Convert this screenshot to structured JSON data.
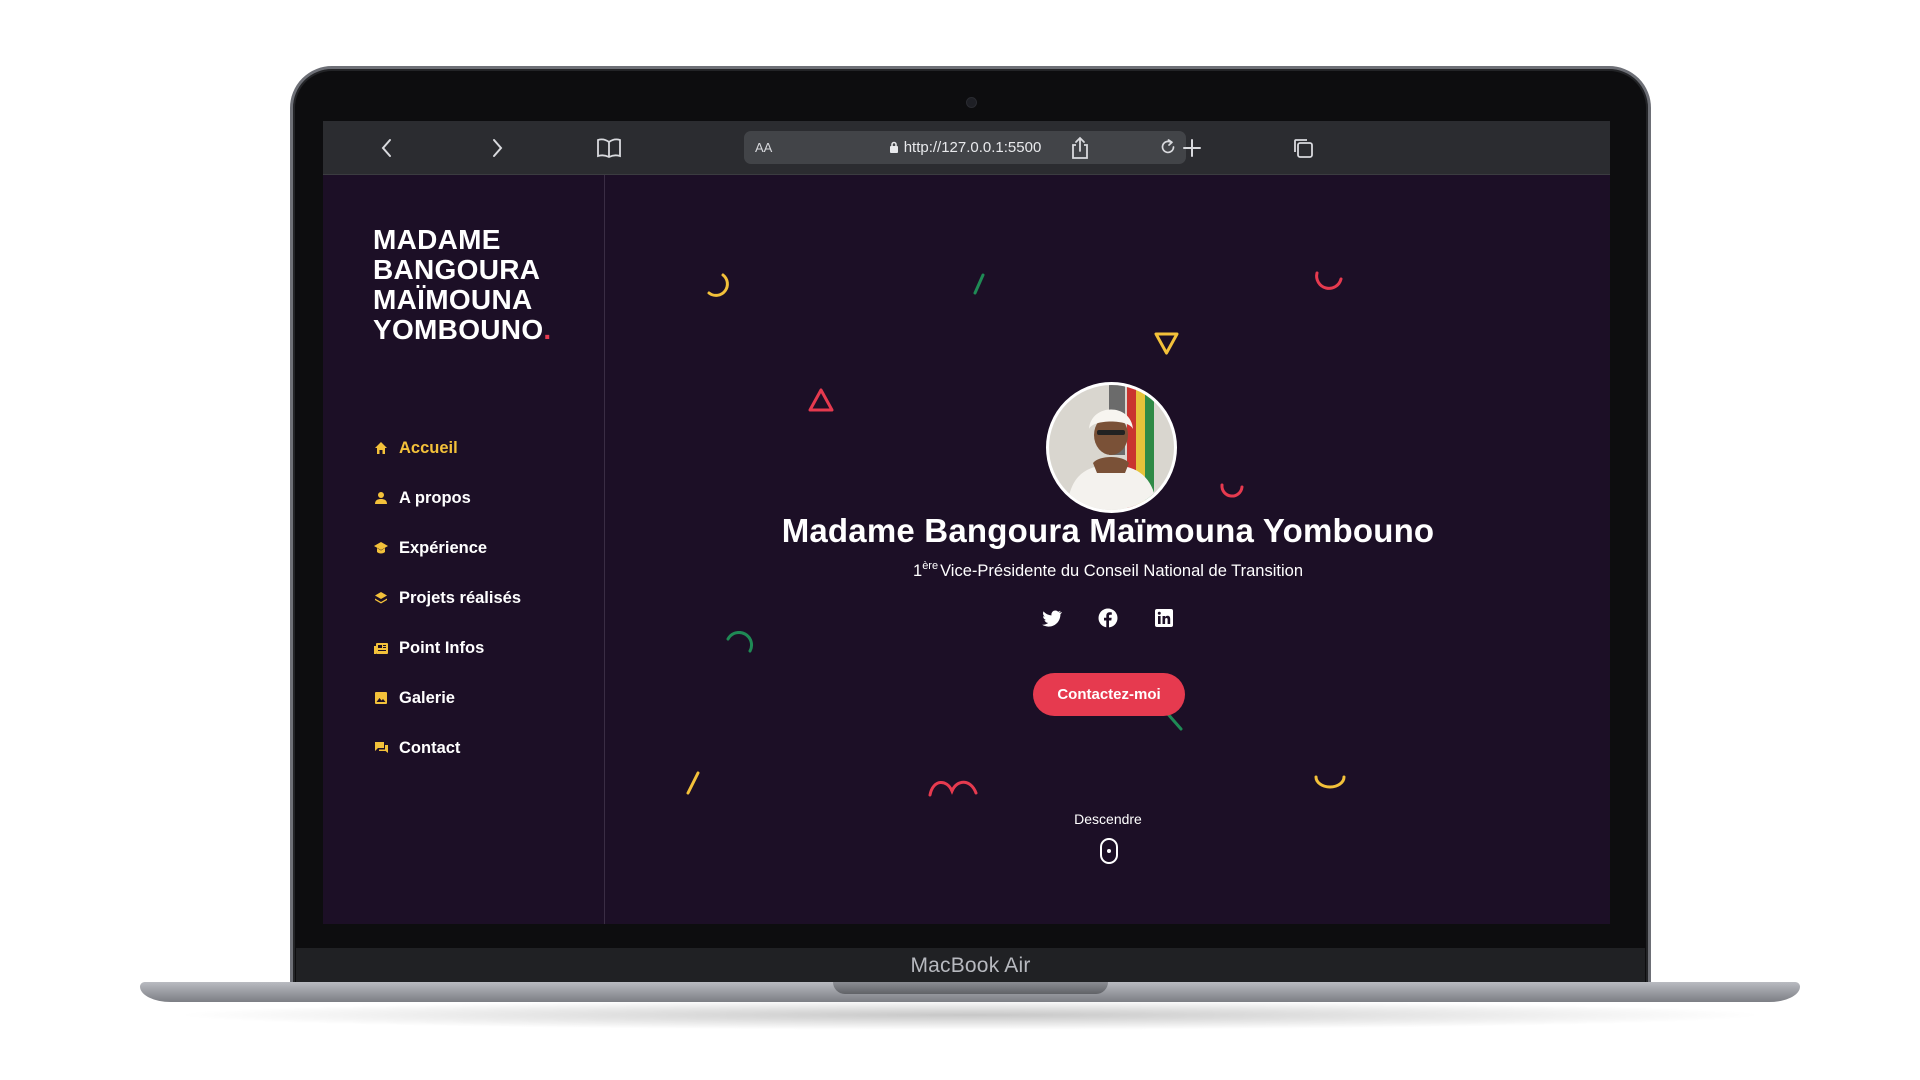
{
  "device": {
    "label": "MacBook Air"
  },
  "browser": {
    "text_size_label": "AA",
    "url": "http://127.0.0.1:5500",
    "toolbar_icons": [
      "chevron-left-icon",
      "chevron-right-icon",
      "book-icon",
      "lock-icon",
      "reload-icon",
      "share-icon",
      "plus-icon",
      "tabs-icon"
    ]
  },
  "sidebar": {
    "brand": {
      "line1": "MADAME",
      "line2": "BANGOURA",
      "line3": "MAÏMOUNA",
      "line4": "YOMBOUNO",
      "dot": "."
    },
    "items": [
      {
        "label": "Accueil",
        "icon": "home-icon",
        "active": true
      },
      {
        "label": "A propos",
        "icon": "user-icon",
        "active": false
      },
      {
        "label": "Expérience",
        "icon": "graduation-cap-icon",
        "active": false
      },
      {
        "label": "Projets réalisés",
        "icon": "layers-icon",
        "active": false
      },
      {
        "label": "Point Infos",
        "icon": "newspaper-icon",
        "active": false
      },
      {
        "label": "Galerie",
        "icon": "image-icon",
        "active": false
      },
      {
        "label": "Contact",
        "icon": "chat-icon",
        "active": false
      }
    ]
  },
  "hero": {
    "name": "Madame Bangoura Maïmouna Yombouno",
    "role_number": "1",
    "role_sup": "ère",
    "role_text": "Vice-Présidente du Conseil National de Transition",
    "socials": [
      "twitter-icon",
      "facebook-icon",
      "linkedin-icon"
    ],
    "cta_label": "Contactez-moi",
    "scroll_label": "Descendre"
  },
  "colors": {
    "background": "#1c0f26",
    "accent_red": "#e63a4f",
    "accent_yellow": "#f3c13a",
    "accent_green": "#1f8a55",
    "text": "#ffffff"
  }
}
